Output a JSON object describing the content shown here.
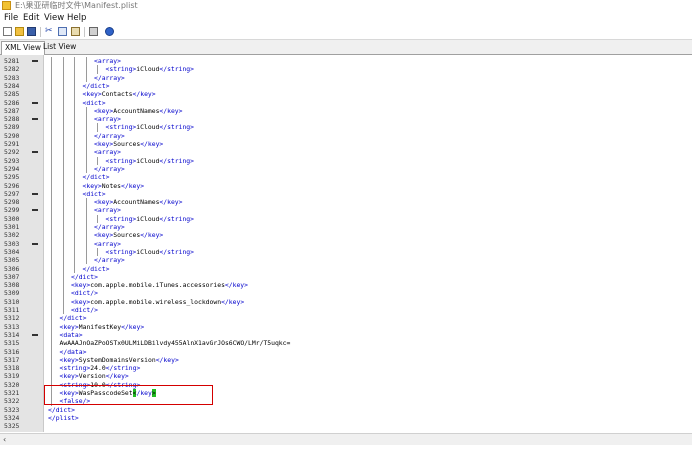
{
  "window": {
    "title": "E:\\果亚研临时文件\\Manifest.plist"
  },
  "menu": {
    "items": [
      "File",
      "Edit",
      "View",
      "Help"
    ]
  },
  "toolbar": {
    "icons": [
      "new-file-icon",
      "open-folder-icon",
      "save-icon",
      "cut-icon",
      "copy-icon",
      "paste-icon",
      "print-icon",
      "help-icon"
    ]
  },
  "tabs": [
    "XML View",
    "List View"
  ],
  "accent": {
    "tag": "#0000cc",
    "cursor": "#22bb22",
    "highlight_box": "#d40000"
  },
  "editor": {
    "lines": [
      {
        "n": "5281",
        "fold": true,
        "ind": 4,
        "pre": "<array>",
        "txt": "",
        "post": ""
      },
      {
        "n": "5282",
        "fold": false,
        "ind": 5,
        "pre": "<string>",
        "txt": "iCloud",
        "post": "</string>"
      },
      {
        "n": "5283",
        "fold": false,
        "ind": 4,
        "pre": "</array>",
        "txt": "",
        "post": ""
      },
      {
        "n": "5284",
        "fold": false,
        "ind": 3,
        "pre": "</dict>",
        "txt": "",
        "post": ""
      },
      {
        "n": "5285",
        "fold": false,
        "ind": 3,
        "pre": "<key>",
        "txt": "Contacts",
        "post": "</key>"
      },
      {
        "n": "5286",
        "fold": true,
        "ind": 3,
        "pre": "<dict>",
        "txt": "",
        "post": ""
      },
      {
        "n": "5287",
        "fold": false,
        "ind": 4,
        "pre": "<key>",
        "txt": "AccountNames",
        "post": "</key>"
      },
      {
        "n": "5288",
        "fold": true,
        "ind": 4,
        "pre": "<array>",
        "txt": "",
        "post": ""
      },
      {
        "n": "5289",
        "fold": false,
        "ind": 5,
        "pre": "<string>",
        "txt": "iCloud",
        "post": "</string>"
      },
      {
        "n": "5290",
        "fold": false,
        "ind": 4,
        "pre": "</array>",
        "txt": "",
        "post": ""
      },
      {
        "n": "5291",
        "fold": false,
        "ind": 4,
        "pre": "<key>",
        "txt": "Sources",
        "post": "</key>"
      },
      {
        "n": "5292",
        "fold": true,
        "ind": 4,
        "pre": "<array>",
        "txt": "",
        "post": ""
      },
      {
        "n": "5293",
        "fold": false,
        "ind": 5,
        "pre": "<string>",
        "txt": "iCloud",
        "post": "</string>"
      },
      {
        "n": "5294",
        "fold": false,
        "ind": 4,
        "pre": "</array>",
        "txt": "",
        "post": ""
      },
      {
        "n": "5295",
        "fold": false,
        "ind": 3,
        "pre": "</dict>",
        "txt": "",
        "post": ""
      },
      {
        "n": "5296",
        "fold": false,
        "ind": 3,
        "pre": "<key>",
        "txt": "Notes",
        "post": "</key>"
      },
      {
        "n": "5297",
        "fold": true,
        "ind": 3,
        "pre": "<dict>",
        "txt": "",
        "post": ""
      },
      {
        "n": "5298",
        "fold": false,
        "ind": 4,
        "pre": "<key>",
        "txt": "AccountNames",
        "post": "</key>"
      },
      {
        "n": "5299",
        "fold": true,
        "ind": 4,
        "pre": "<array>",
        "txt": "",
        "post": ""
      },
      {
        "n": "5300",
        "fold": false,
        "ind": 5,
        "pre": "<string>",
        "txt": "iCloud",
        "post": "</string>"
      },
      {
        "n": "5301",
        "fold": false,
        "ind": 4,
        "pre": "</array>",
        "txt": "",
        "post": ""
      },
      {
        "n": "5302",
        "fold": false,
        "ind": 4,
        "pre": "<key>",
        "txt": "Sources",
        "post": "</key>"
      },
      {
        "n": "5303",
        "fold": true,
        "ind": 4,
        "pre": "<array>",
        "txt": "",
        "post": ""
      },
      {
        "n": "5304",
        "fold": false,
        "ind": 5,
        "pre": "<string>",
        "txt": "iCloud",
        "post": "</string>"
      },
      {
        "n": "5305",
        "fold": false,
        "ind": 4,
        "pre": "</array>",
        "txt": "",
        "post": ""
      },
      {
        "n": "5306",
        "fold": false,
        "ind": 3,
        "pre": "</dict>",
        "txt": "",
        "post": ""
      },
      {
        "n": "5307",
        "fold": false,
        "ind": 2,
        "pre": "</dict>",
        "txt": "",
        "post": ""
      },
      {
        "n": "5308",
        "fold": false,
        "ind": 2,
        "pre": "<key>",
        "txt": "com.apple.mobile.iTunes.accessories",
        "post": "</key>"
      },
      {
        "n": "5309",
        "fold": false,
        "ind": 2,
        "pre": "<dict/>",
        "txt": "",
        "post": ""
      },
      {
        "n": "5310",
        "fold": false,
        "ind": 2,
        "pre": "<key>",
        "txt": "com.apple.mobile.wireless_lockdown",
        "post": "</key>"
      },
      {
        "n": "5311",
        "fold": false,
        "ind": 2,
        "pre": "<dict/>",
        "txt": "",
        "post": ""
      },
      {
        "n": "5312",
        "fold": false,
        "ind": 1,
        "pre": "</dict>",
        "txt": "",
        "post": ""
      },
      {
        "n": "5313",
        "fold": false,
        "ind": 1,
        "pre": "<key>",
        "txt": "ManifestKey",
        "post": "</key>"
      },
      {
        "n": "5314",
        "fold": true,
        "ind": 1,
        "pre": "<data>",
        "txt": "",
        "post": ""
      },
      {
        "n": "5315",
        "fold": false,
        "ind": 1,
        "pre": "",
        "txt": "AwAAAJnOaZPoOSTx0ULMiLDBilvdy455AlnX1avGrJOs6CWO/LMr/T5uqkc=",
        "post": ""
      },
      {
        "n": "5316",
        "fold": false,
        "ind": 1,
        "pre": "</data>",
        "txt": "",
        "post": ""
      },
      {
        "n": "5317",
        "fold": false,
        "ind": 1,
        "pre": "<key>",
        "txt": "SystemDomainsVersion",
        "post": "</key>"
      },
      {
        "n": "5318",
        "fold": false,
        "ind": 1,
        "pre": "<string>",
        "txt": "24.0",
        "post": "</string>"
      },
      {
        "n": "5319",
        "fold": false,
        "ind": 1,
        "pre": "<key>",
        "txt": "Version",
        "post": "</key>"
      },
      {
        "n": "5320",
        "fold": false,
        "ind": 1,
        "pre": "<string>",
        "txt": "10.0",
        "post": "</string>"
      },
      {
        "n": "5321",
        "fold": false,
        "ind": 1,
        "pre": "<key>",
        "txt": "WasPasscodeSet",
        "post": "</key>",
        "cursor": true
      },
      {
        "n": "5322",
        "fold": false,
        "ind": 1,
        "pre": "<false/>",
        "txt": "",
        "post": ""
      },
      {
        "n": "5323",
        "fold": false,
        "ind": 0,
        "pre": "</dict>",
        "txt": "",
        "post": ""
      },
      {
        "n": "5324",
        "fold": false,
        "ind": 0,
        "pre": "</plist>",
        "txt": "",
        "post": ""
      },
      {
        "n": "5325",
        "fold": false,
        "ind": 0,
        "pre": "",
        "txt": "",
        "post": ""
      }
    ]
  }
}
